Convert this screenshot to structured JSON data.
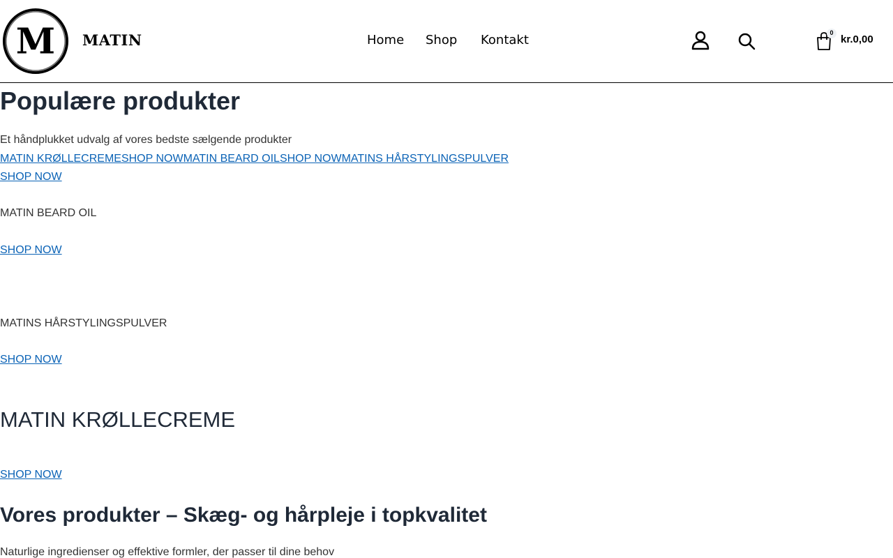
{
  "header": {
    "brand": "MATIN",
    "logo_letter": "M",
    "nav": [
      {
        "label": "Home"
      },
      {
        "label": "Shop"
      },
      {
        "label": "Kontakt"
      }
    ],
    "cart_count": "0",
    "cart_total": "kr.0,00"
  },
  "main": {
    "heading": "Populære produkter",
    "subtitle": "Et håndplukket udvalg af vores bedste sælgende produkter",
    "product_links": [
      {
        "label": "MATIN KRØLLECREME"
      },
      {
        "label": "SHOP NOW"
      },
      {
        "label": "MATIN BEARD OIL"
      },
      {
        "label": "SHOP NOW"
      },
      {
        "label": "MATINS HÅRSTYLINGSPULVER"
      }
    ],
    "shop_now_1": "SHOP NOW",
    "product_beard": "MATIN BEARD OIL",
    "shop_now_2": "SHOP NOW",
    "product_powder": "MATINS HÅRSTYLINGSPULVER",
    "shop_now_3": "SHOP NOW",
    "product_krolle": "MATIN KRØLLECREME",
    "shop_now_4": "SHOP NOW",
    "section_heading": "Vores produkter – Skæg- og hårpleje i topkvalitet",
    "section_text": "Naturlige ingredienser og effektive formler, der passer til dine behov"
  },
  "colors": {
    "link": "#0b63b6",
    "heading": "#1f2937",
    "text": "#333333"
  },
  "icons": [
    "user-icon",
    "search-icon",
    "cart-icon"
  ]
}
